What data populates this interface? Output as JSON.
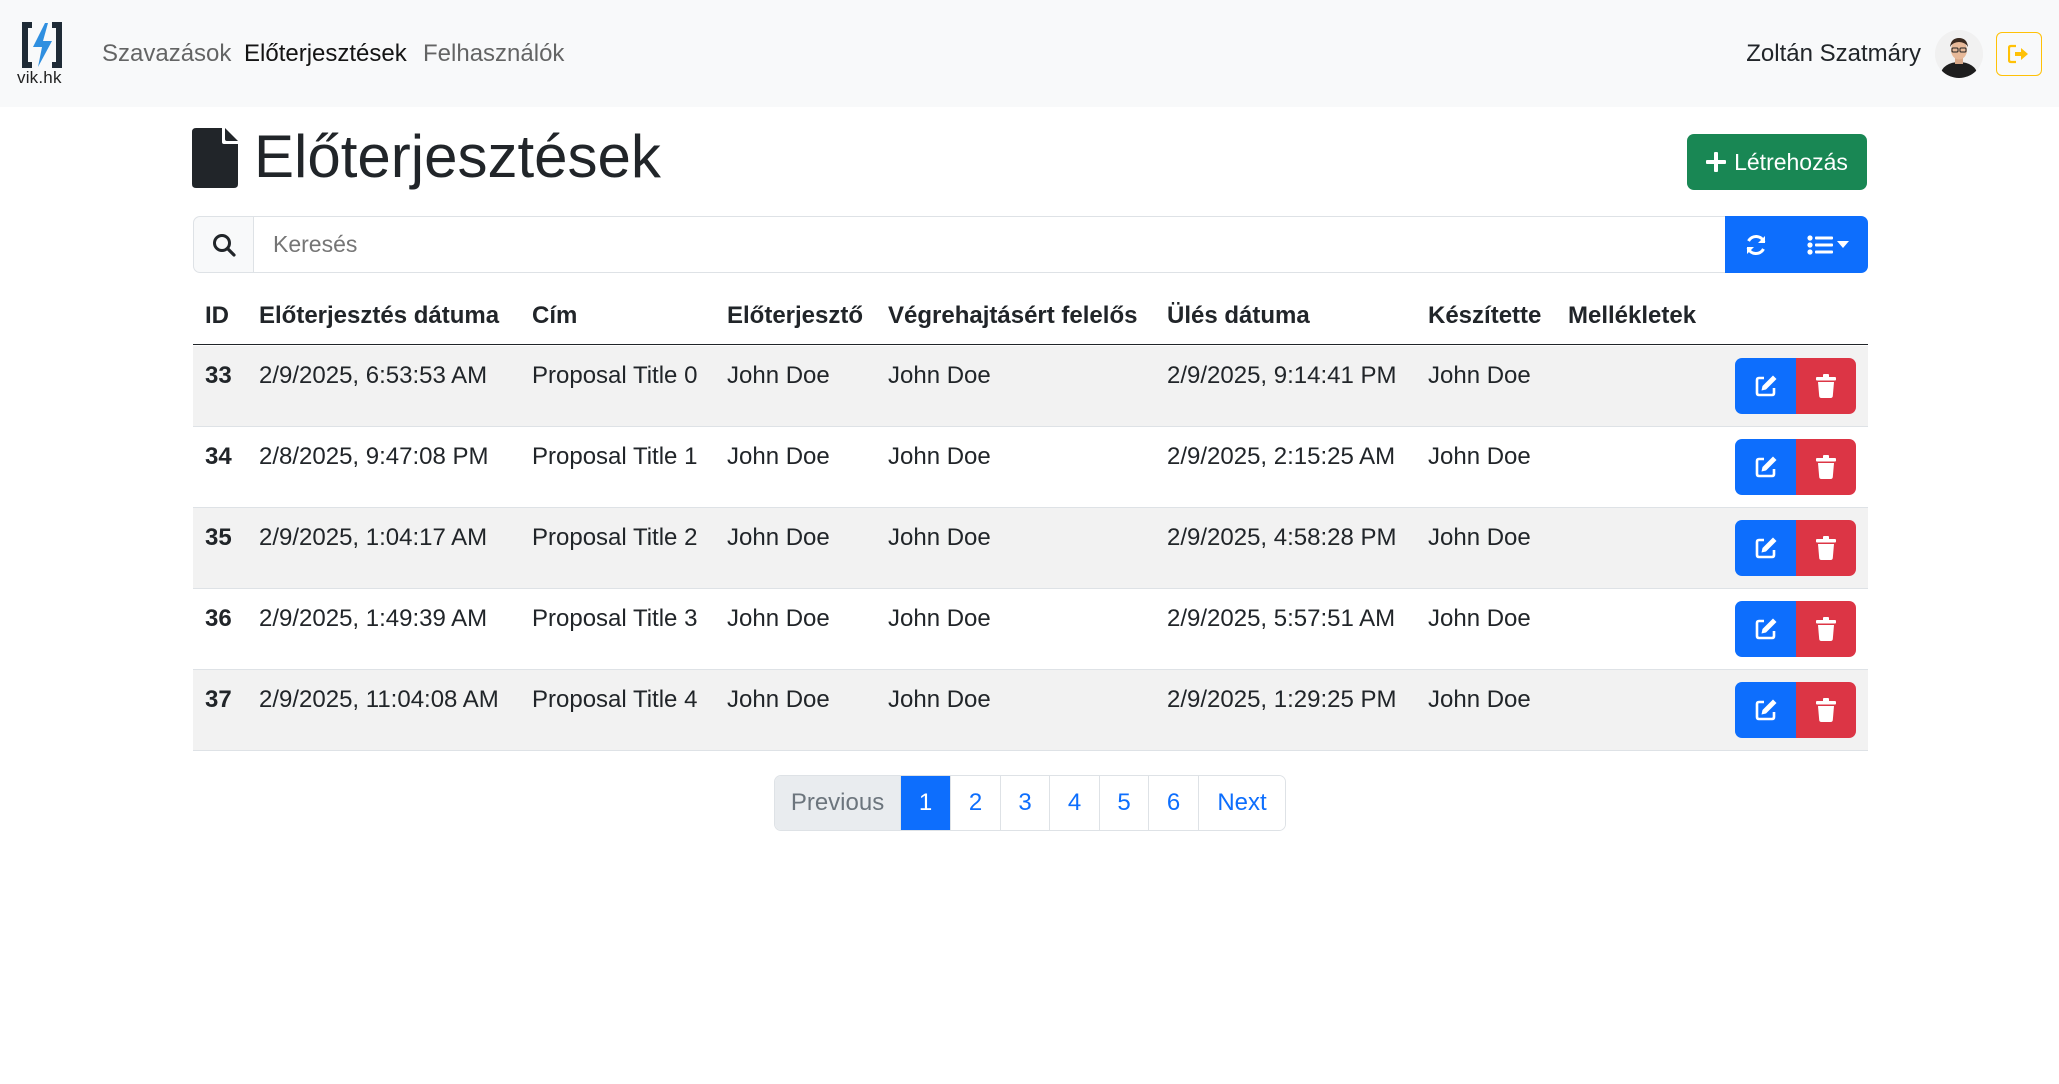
{
  "nav": {
    "brand": "vik.hk",
    "links": [
      "Szavazások",
      "Előterjesztések",
      "Felhasználók"
    ],
    "active_link": "Előterjesztések",
    "user_name": "Zoltán Szatmáry"
  },
  "page": {
    "title": "Előterjesztések",
    "create_label": "Létrehozás"
  },
  "search": {
    "placeholder": "Keresés"
  },
  "table": {
    "columns": [
      "ID",
      "Előterjesztés dátuma",
      "Cím",
      "Előterjesztő",
      "Végrehajtásért felelős",
      "Ülés dátuma",
      "Készítette",
      "Mellékletek"
    ],
    "rows": [
      {
        "id": "33",
        "date": "2/9/2025, 6:53:53 AM",
        "title": "Proposal Title 0",
        "proposer": "John Doe",
        "responsible": "John Doe",
        "meeting_date": "2/9/2025, 9:14:41 PM",
        "created_by": "John Doe",
        "attachments": ""
      },
      {
        "id": "34",
        "date": "2/8/2025, 9:47:08 PM",
        "title": "Proposal Title 1",
        "proposer": "John Doe",
        "responsible": "John Doe",
        "meeting_date": "2/9/2025, 2:15:25 AM",
        "created_by": "John Doe",
        "attachments": ""
      },
      {
        "id": "35",
        "date": "2/9/2025, 1:04:17 AM",
        "title": "Proposal Title 2",
        "proposer": "John Doe",
        "responsible": "John Doe",
        "meeting_date": "2/9/2025, 4:58:28 PM",
        "created_by": "John Doe",
        "attachments": ""
      },
      {
        "id": "36",
        "date": "2/9/2025, 1:49:39 AM",
        "title": "Proposal Title 3",
        "proposer": "John Doe",
        "responsible": "John Doe",
        "meeting_date": "2/9/2025, 5:57:51 AM",
        "created_by": "John Doe",
        "attachments": ""
      },
      {
        "id": "37",
        "date": "2/9/2025, 11:04:08 AM",
        "title": "Proposal Title 4",
        "proposer": "John Doe",
        "responsible": "John Doe",
        "meeting_date": "2/9/2025, 1:29:25 PM",
        "created_by": "John Doe",
        "attachments": ""
      }
    ]
  },
  "pagination": {
    "previous": "Previous",
    "pages": [
      "1",
      "2",
      "3",
      "4",
      "5",
      "6"
    ],
    "current": "1",
    "next": "Next"
  },
  "colors": {
    "primary": "#0d6efd",
    "success": "#198754",
    "danger": "#dc3545",
    "warning": "#ffc107",
    "navbar_bg": "#f8f9fa",
    "stripe": "#f2f2f2"
  },
  "icons": {
    "brand": "lightning-bracket-logo",
    "logout": "sign-out-icon",
    "page": "file-icon",
    "create": "plus-icon",
    "search": "search-icon",
    "refresh": "refresh-icon",
    "view": "list-icon",
    "edit": "edit-icon",
    "delete": "trash-icon"
  }
}
